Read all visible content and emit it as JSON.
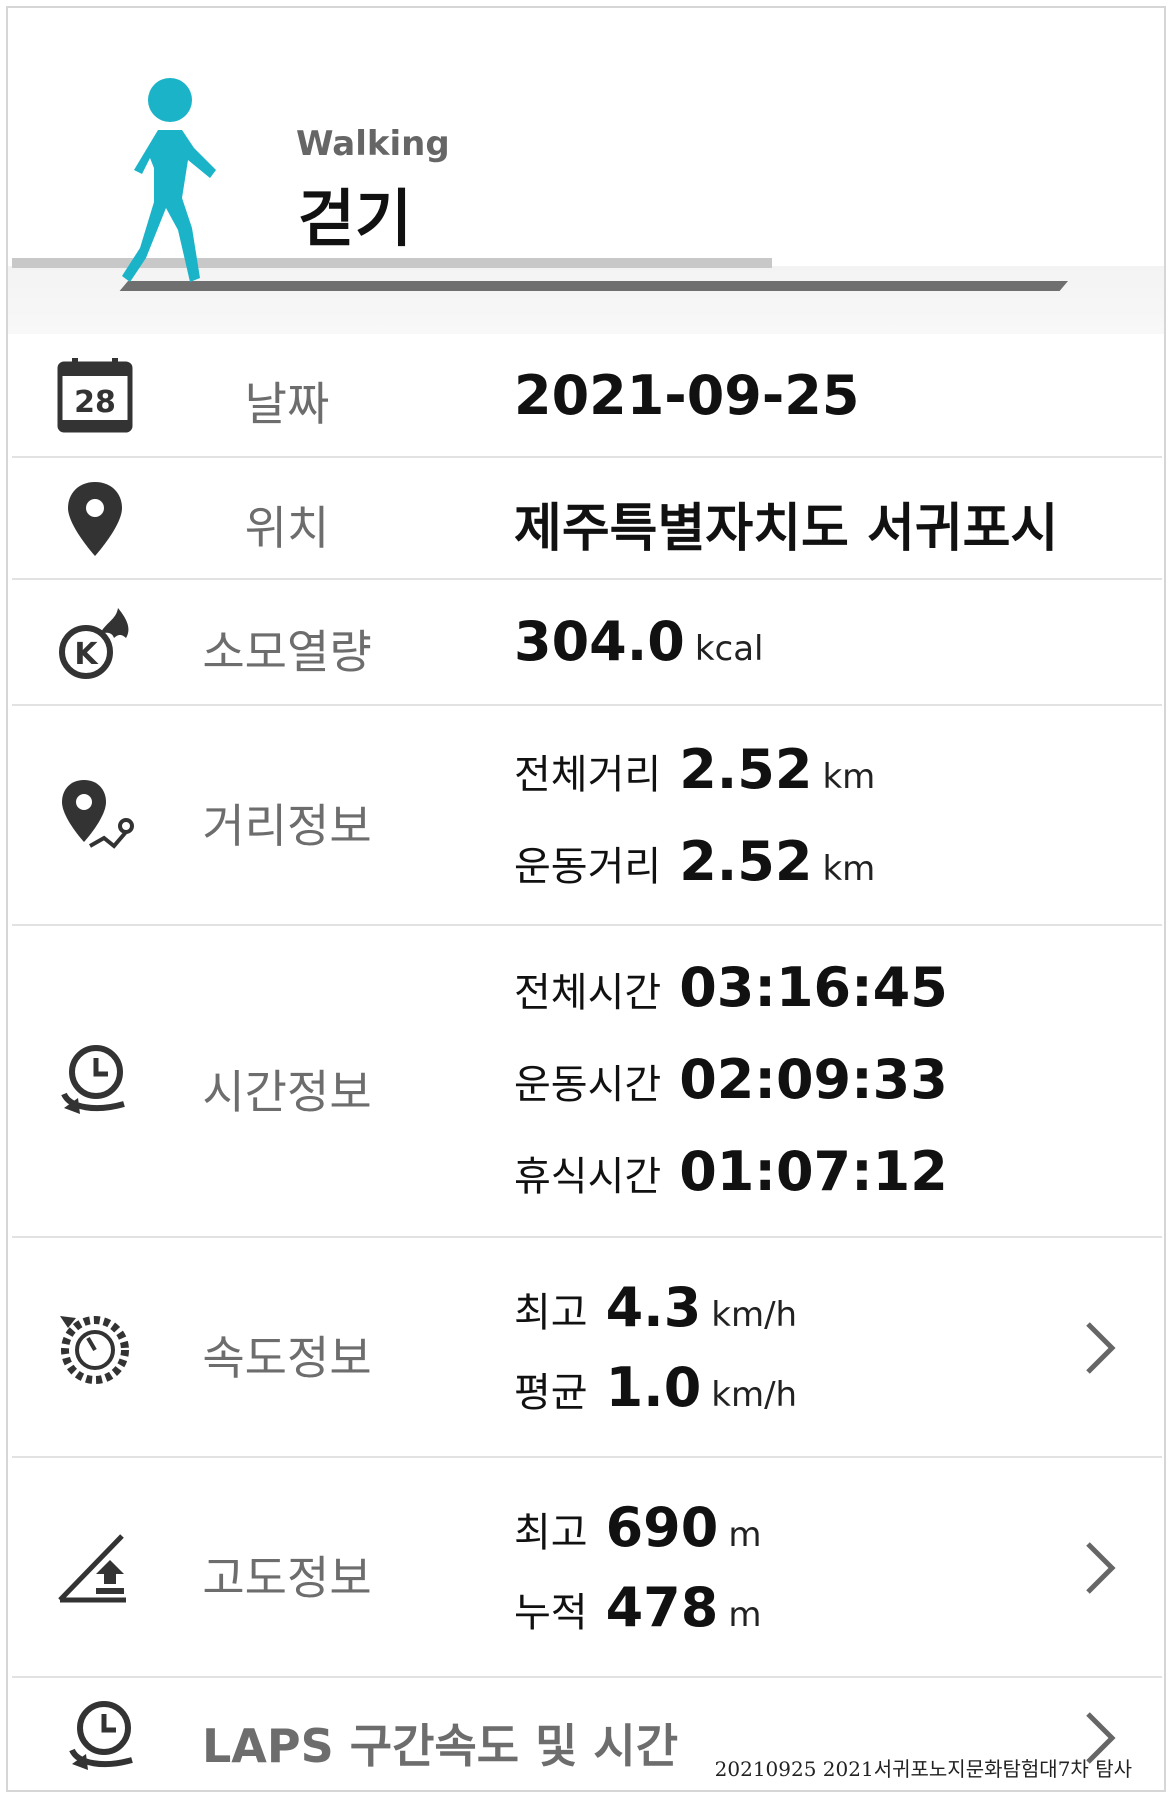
{
  "header": {
    "activity_en": "Walking",
    "activity_ko": "걷기"
  },
  "rows": {
    "date": {
      "label": "날짜",
      "value": "2021-09-25",
      "icon": "calendar-icon",
      "calendar_day": "28"
    },
    "location": {
      "label": "위치",
      "value": "제주특별자치도 서귀포시",
      "icon": "map-pin-icon"
    },
    "calories": {
      "label": "소모열량",
      "value": "304.0",
      "unit": "kcal",
      "icon": "calorie-fire-icon"
    },
    "distance": {
      "label": "거리정보",
      "icon": "route-pin-icon",
      "items": [
        {
          "key": "전체거리",
          "value": "2.52",
          "unit": "km"
        },
        {
          "key": "운동거리",
          "value": "2.52",
          "unit": "km"
        }
      ]
    },
    "time": {
      "label": "시간정보",
      "icon": "clock-cycle-icon",
      "items": [
        {
          "key": "전체시간",
          "value": "03:16:45"
        },
        {
          "key": "운동시간",
          "value": "02:09:33"
        },
        {
          "key": "휴식시간",
          "value": "01:07:12"
        }
      ]
    },
    "speed": {
      "label": "속도정보",
      "icon": "speedometer-icon",
      "items": [
        {
          "key": "최고",
          "value": "4.3",
          "unit": "km/h"
        },
        {
          "key": "평균",
          "value": "1.0",
          "unit": "km/h"
        }
      ]
    },
    "altitude": {
      "label": "고도정보",
      "icon": "altitude-slope-icon",
      "items": [
        {
          "key": "최고",
          "value": "690",
          "unit": "m"
        },
        {
          "key": "누적",
          "value": "478",
          "unit": "m"
        }
      ]
    },
    "laps": {
      "label": "LAPS 구간속도 및 시간",
      "icon": "laps-clock-icon"
    }
  },
  "watermark": "20210925 2021서귀포노지문화탐험대7차 탐사",
  "colors": {
    "accent": "#1bb3c8",
    "label_gray": "#6d6d6d",
    "icon_dark": "#333333"
  }
}
